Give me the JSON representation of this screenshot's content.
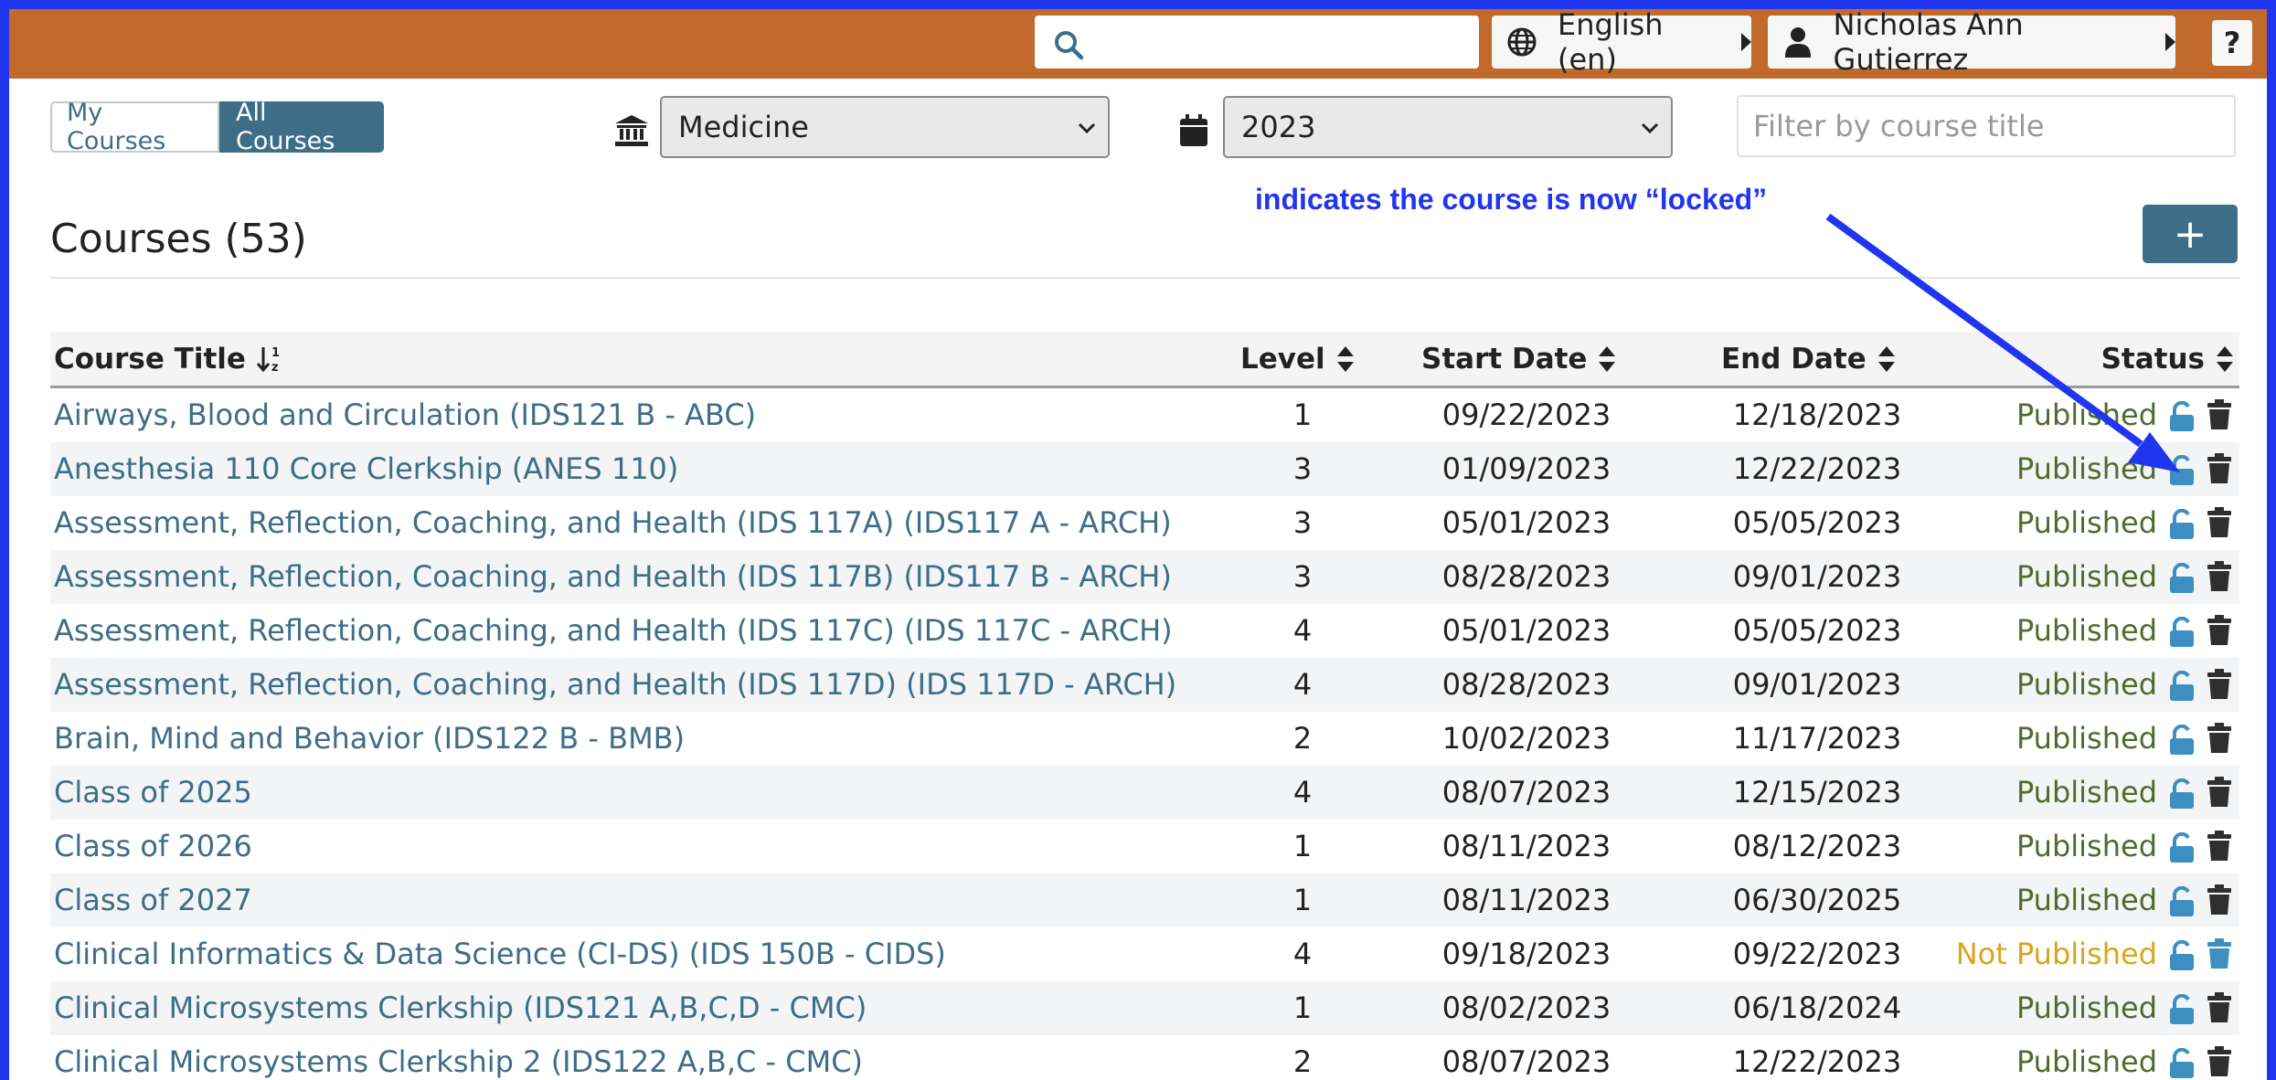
{
  "header": {
    "search_value": "",
    "language_label": "English (en)",
    "user_label": "Nicholas Ann Gutierrez",
    "help_label": "?"
  },
  "toolbar": {
    "my_courses_label": "My Courses",
    "all_courses_label": "All Courses",
    "school_value": "Medicine",
    "year_value": "2023",
    "filter_placeholder": "Filter by course title",
    "add_label": "+"
  },
  "annotation_text": "indicates the course is now “locked”",
  "page_title": "Courses (53)",
  "table": {
    "headers": {
      "title": "Course Title",
      "level": "Level",
      "start": "Start Date",
      "end": "End Date",
      "status": "Status"
    },
    "rows": [
      {
        "title": "Airways, Blood and Circulation (IDS121 B - ABC)",
        "level": "1",
        "start": "09/22/2023",
        "end": "12/18/2023",
        "status": "Published"
      },
      {
        "title": "Anesthesia 110 Core Clerkship (ANES 110)",
        "level": "3",
        "start": "01/09/2023",
        "end": "12/22/2023",
        "status": "Published"
      },
      {
        "title": "Assessment, Reflection, Coaching, and Health (IDS 117A) (IDS117 A - ARCH)",
        "level": "3",
        "start": "05/01/2023",
        "end": "05/05/2023",
        "status": "Published"
      },
      {
        "title": "Assessment, Reflection, Coaching, and Health (IDS 117B) (IDS117 B - ARCH)",
        "level": "3",
        "start": "08/28/2023",
        "end": "09/01/2023",
        "status": "Published"
      },
      {
        "title": "Assessment, Reflection, Coaching, and Health (IDS 117C) (IDS 117C - ARCH)",
        "level": "4",
        "start": "05/01/2023",
        "end": "05/05/2023",
        "status": "Published"
      },
      {
        "title": "Assessment, Reflection, Coaching, and Health (IDS 117D) (IDS 117D - ARCH)",
        "level": "4",
        "start": "08/28/2023",
        "end": "09/01/2023",
        "status": "Published"
      },
      {
        "title": "Brain, Mind and Behavior (IDS122 B - BMB)",
        "level": "2",
        "start": "10/02/2023",
        "end": "11/17/2023",
        "status": "Published"
      },
      {
        "title": "Class of 2025",
        "level": "4",
        "start": "08/07/2023",
        "end": "12/15/2023",
        "status": "Published"
      },
      {
        "title": "Class of 2026",
        "level": "1",
        "start": "08/11/2023",
        "end": "08/12/2023",
        "status": "Published"
      },
      {
        "title": "Class of 2027",
        "level": "1",
        "start": "08/11/2023",
        "end": "06/30/2025",
        "status": "Published"
      },
      {
        "title": "Clinical Informatics & Data Science (CI-DS) (IDS 150B - CIDS)",
        "level": "4",
        "start": "09/18/2023",
        "end": "09/22/2023",
        "status": "Not Published"
      },
      {
        "title": "Clinical Microsystems Clerkship (IDS121 A,B,C,D - CMC)",
        "level": "1",
        "start": "08/02/2023",
        "end": "06/18/2024",
        "status": "Published"
      },
      {
        "title": "Clinical Microsystems Clerkship 2 (IDS122 A,B,C - CMC)",
        "level": "2",
        "start": "08/07/2023",
        "end": "12/22/2023",
        "status": "Published"
      }
    ]
  },
  "colors": {
    "header_bg": "#c16a2b",
    "accent": "#3e6e87",
    "published": "#4f6b2e",
    "not_published": "#d9a51c",
    "annotation": "#1f35ee"
  }
}
